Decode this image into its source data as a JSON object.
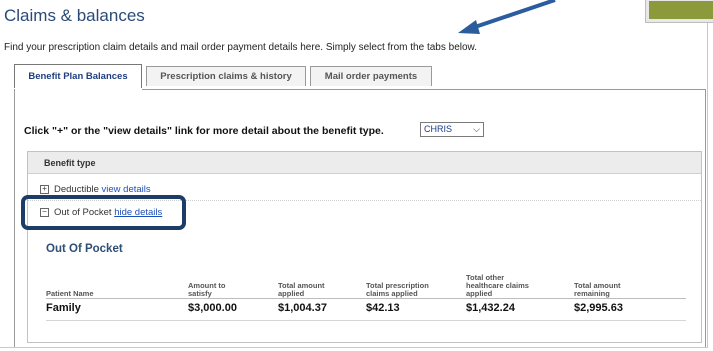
{
  "page": {
    "title": "Claims & balances",
    "intro": "Find your prescription claim details and mail order payment details here. Simply select from the tabs below."
  },
  "tabs": [
    {
      "label": "Benefit Plan Balances",
      "active": true
    },
    {
      "label": "Prescription claims & history",
      "active": false
    },
    {
      "label": "Mail order payments",
      "active": false
    }
  ],
  "instruction": "Click \"+\" or the \"view details\" link for more detail about the benefit type.",
  "member_select": {
    "value": "CHRIS"
  },
  "benefit_table": {
    "header": "Benefit type",
    "rows": [
      {
        "toggle": "+",
        "label": "Deductible",
        "link": "view details"
      },
      {
        "toggle": "−",
        "label": "Out of Pocket",
        "link": "hide details"
      }
    ]
  },
  "out_of_pocket": {
    "title": "Out Of Pocket",
    "columns": [
      "Patient Name",
      "Amount to satisfy",
      "Total amount applied",
      "Total prescription claims applied",
      "Total other healthcare claims applied",
      "Total amount remaining"
    ],
    "rows": [
      {
        "patient": "Family",
        "amount_to_satisfy": "$3,000.00",
        "total_applied": "$1,004.37",
        "prescription_applied": "$42.13",
        "other_applied": "$1,432.24",
        "remaining": "$2,995.63"
      }
    ]
  },
  "colors": {
    "title": "#2a4a78",
    "link": "#1d4fb8",
    "highlight": "#1e3d66",
    "arrow": "#2b5c9e",
    "olive": "#8d9a3c"
  }
}
